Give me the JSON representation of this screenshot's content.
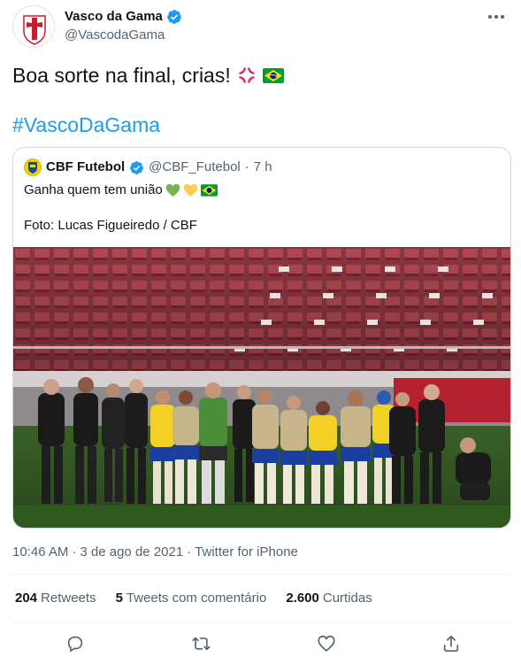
{
  "author": {
    "display_name": "Vasco da Gama",
    "handle": "@VascodaGama",
    "avatar": "vasco-crest-icon",
    "verified": true
  },
  "tweet": {
    "text": "Boa sorte na final, crias!",
    "emojis": [
      "anger-symbol-emoji",
      "brazil-flag-emoji"
    ],
    "hashtag": "#VascoDaGama"
  },
  "quoted_tweet": {
    "display_name": "CBF Futebol",
    "handle": "@CBF_Futebol",
    "separator": "·",
    "time": "7 h",
    "verified": true,
    "text": "Ganha quem tem união",
    "text_emojis": [
      "green-heart-emoji",
      "yellow-heart-emoji",
      "brazil-flag-emoji"
    ],
    "photo_credit": "Foto: Lucas Figueiredo / CBF",
    "photo": "brazil-team-sideline-photo"
  },
  "meta": {
    "time": "10:46 AM",
    "separator1": "·",
    "date": "3 de ago de 2021",
    "separator2": "·",
    "source": "Twitter for iPhone"
  },
  "stats": [
    {
      "count": "204",
      "label": "Retweets"
    },
    {
      "count": "5",
      "label": "Tweets com comentário"
    },
    {
      "count": "2.600",
      "label": "Curtidas"
    }
  ],
  "actions": [
    "reply-icon",
    "retweet-icon",
    "like-icon",
    "share-icon"
  ],
  "colors": {
    "accent": "#1d9bf0",
    "text": "#0f1419",
    "muted": "#536471",
    "border": "#cfd9de",
    "divider": "#eff3f4"
  }
}
